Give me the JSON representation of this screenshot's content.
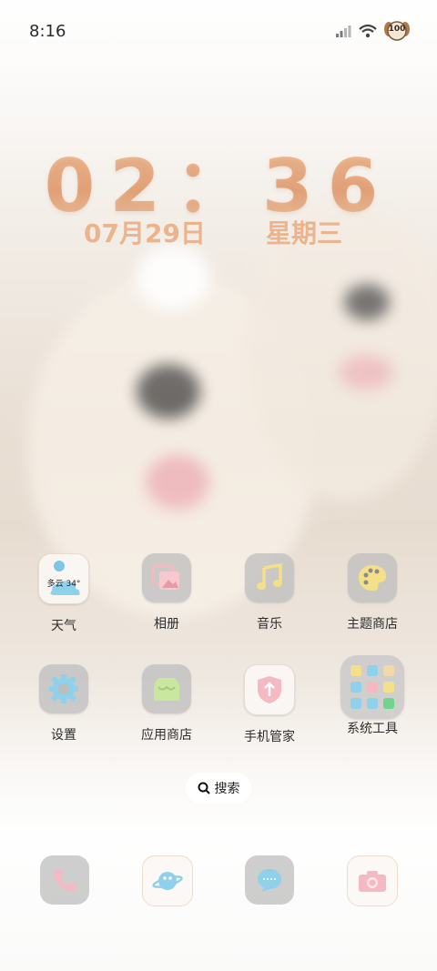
{
  "status_bar": {
    "time": "8:16",
    "battery": "100"
  },
  "lock_clock": {
    "time": "02：36",
    "date": "07月29日",
    "weekday": "星期三"
  },
  "weather_widget": {
    "condition": "多云",
    "temperature": "34°"
  },
  "apps": [
    {
      "label": "天气",
      "icon": "weather-icon"
    },
    {
      "label": "相册",
      "icon": "photos-icon"
    },
    {
      "label": "音乐",
      "icon": "music-icon"
    },
    {
      "label": "主题商店",
      "icon": "theme-store-icon"
    },
    {
      "label": "设置",
      "icon": "settings-icon"
    },
    {
      "label": "应用商店",
      "icon": "app-store-icon"
    },
    {
      "label": "手机管家",
      "icon": "phone-manager-icon"
    },
    {
      "label": "系统工具",
      "icon": "system-tools-folder-icon"
    }
  ],
  "search": {
    "label": "搜索"
  },
  "dock": [
    {
      "icon": "phone-icon"
    },
    {
      "icon": "browser-icon"
    },
    {
      "icon": "messages-icon"
    },
    {
      "icon": "camera-icon"
    }
  ],
  "colors": {
    "clock_accent": "#ecb48d",
    "icon_pink": "#f4b9c2",
    "icon_yellow": "#f5e08a",
    "icon_blue": "#8fd0ea",
    "icon_green": "#c9e79f"
  }
}
